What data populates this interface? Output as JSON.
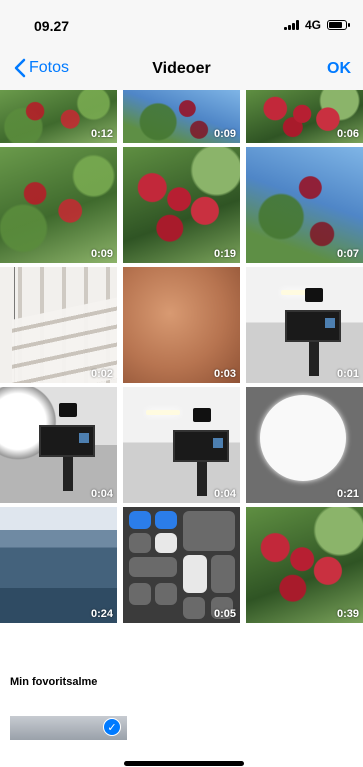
{
  "status": {
    "time": "09.27",
    "network": "4G",
    "battery_level": 0.85
  },
  "nav": {
    "back_label": "Fotos",
    "title": "Videoer",
    "ok_label": "OK"
  },
  "grid": {
    "row0": [
      {
        "duration": "0:12",
        "thumb": "apple-leaves"
      },
      {
        "duration": "0:09",
        "thumb": "leaves-sky"
      },
      {
        "duration": "0:06",
        "thumb": "apples-big"
      }
    ],
    "row1": [
      {
        "duration": "0:09",
        "thumb": "apple-leaves"
      },
      {
        "duration": "0:19",
        "thumb": "apples-big"
      },
      {
        "duration": "0:07",
        "thumb": "leaves-sky"
      }
    ],
    "row2": [
      {
        "duration": "0:02",
        "thumb": "keyboard"
      },
      {
        "duration": "0:03",
        "thumb": "skin"
      },
      {
        "duration": "0:01",
        "thumb": "room"
      }
    ],
    "row3": [
      {
        "duration": "0:04",
        "thumb": "room-dark"
      },
      {
        "duration": "0:04",
        "thumb": "room"
      },
      {
        "duration": "0:21",
        "thumb": "circle-light"
      }
    ],
    "row4": [
      {
        "duration": "0:24",
        "thumb": "sea"
      },
      {
        "duration": "0:05",
        "thumb": "control-center"
      },
      {
        "duration": "0:39",
        "thumb": "apples-big"
      }
    ]
  },
  "album": {
    "title": "Min fovoritsalme",
    "selected": true
  },
  "colors": {
    "accent": "#007aff"
  }
}
